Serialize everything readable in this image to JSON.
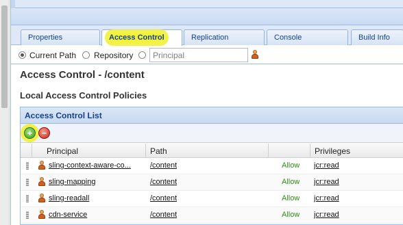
{
  "tabs": [
    {
      "label": "Properties"
    },
    {
      "label": "Access Control"
    },
    {
      "label": "Replication"
    },
    {
      "label": "Console"
    },
    {
      "label": "Build Info"
    }
  ],
  "pathbar": {
    "current_path_label": "Current Path",
    "repository_label": "Repository",
    "principal_placeholder": "Principal",
    "selected": "Current Path"
  },
  "page": {
    "title": "Access Control - /content",
    "subtitle": "Local Access Control Policies"
  },
  "acl": {
    "title": "Access Control List",
    "columns": [
      "Principal",
      "Path",
      "",
      "Privileges"
    ],
    "rows": [
      {
        "principal": "sling-context-aware-co...",
        "path": "/content",
        "type": "Allow",
        "privileges": "jcr:read"
      },
      {
        "principal": "sling-mapping",
        "path": "/content",
        "type": "Allow",
        "privileges": "jcr:read"
      },
      {
        "principal": "sling-readall",
        "path": "/content",
        "type": "Allow",
        "privileges": "jcr:read"
      },
      {
        "principal": "cdn-service",
        "path": "/content",
        "type": "Allow",
        "privileges": "jcr:read"
      }
    ]
  },
  "icons": {
    "add": "add-icon",
    "remove": "remove-icon",
    "principal_picker": "user-icon"
  },
  "colors": {
    "accent": "#15428b",
    "highlight": "#f2f23a",
    "allow": "#2f8a18"
  }
}
